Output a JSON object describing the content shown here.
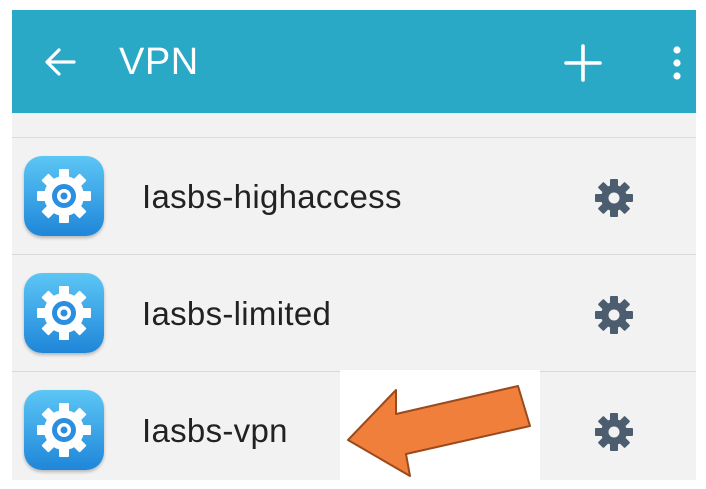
{
  "header": {
    "title": "VPN",
    "background_color": "#2aa9c7",
    "icons": {
      "back": "arrow-left-icon",
      "add": "plus-icon",
      "more": "more-vertical-icon"
    }
  },
  "vpn_list": [
    {
      "name": "Iasbs-highaccess",
      "icon": "app-gear-icon",
      "action_icon": "settings-gear-icon"
    },
    {
      "name": "Iasbs-limited",
      "icon": "app-gear-icon",
      "action_icon": "settings-gear-icon"
    },
    {
      "name": "Iasbs-vpn",
      "icon": "app-gear-icon",
      "action_icon": "settings-gear-icon"
    }
  ],
  "annotation": {
    "arrow_color": "#ef7f3a"
  }
}
